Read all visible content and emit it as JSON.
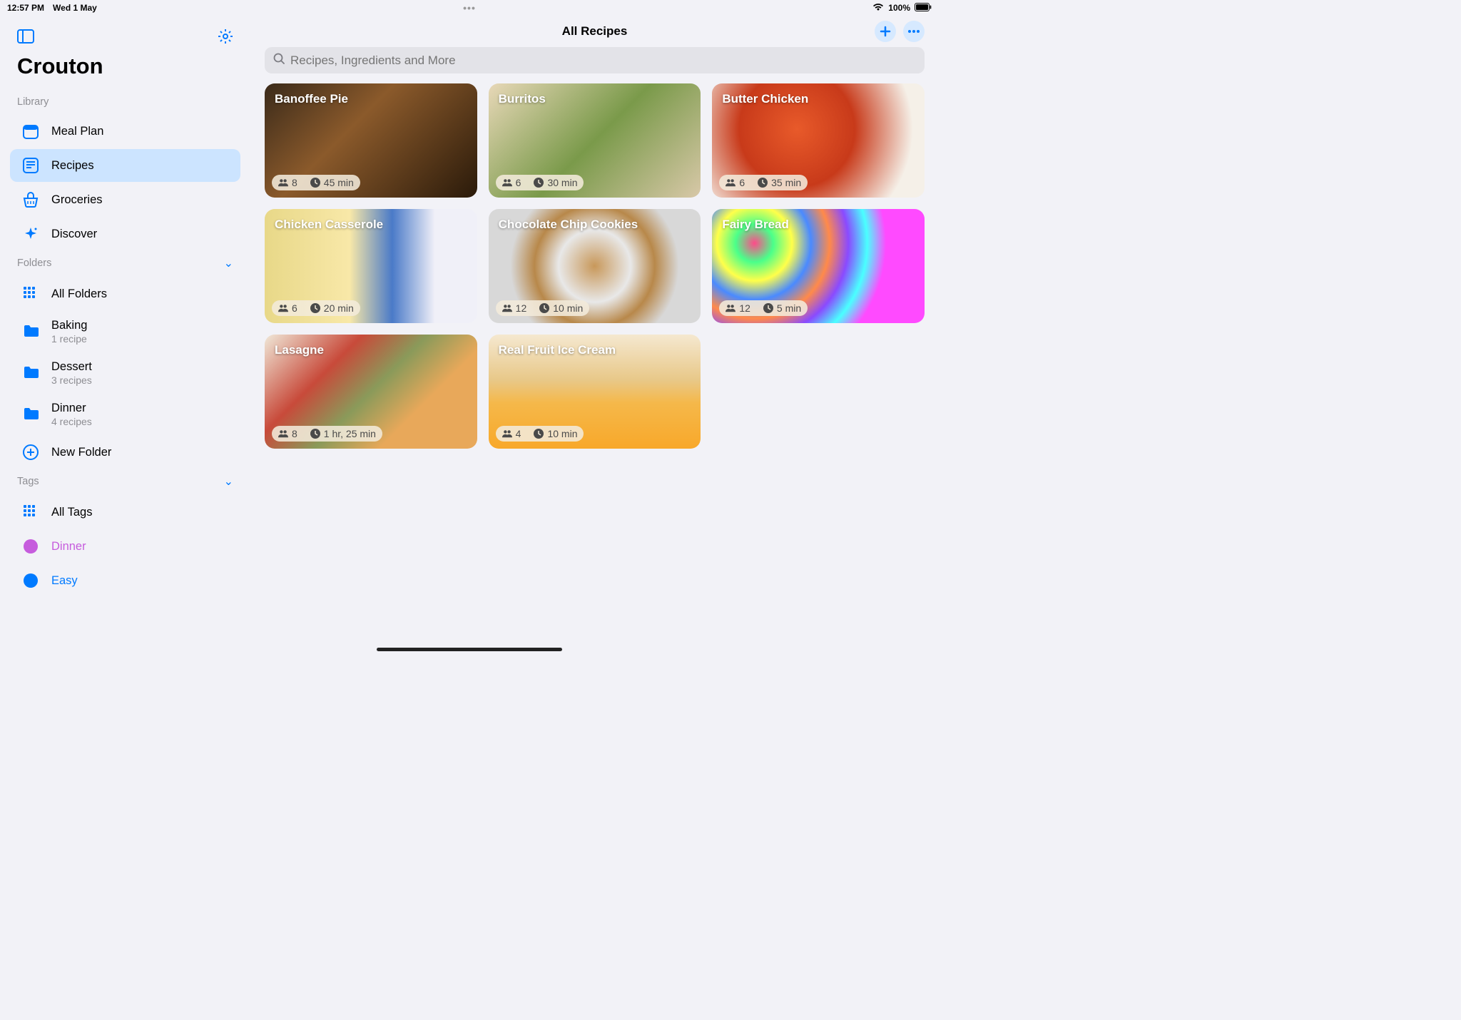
{
  "status": {
    "time": "12:57 PM",
    "date": "Wed 1 May",
    "battery": "100%"
  },
  "app_name": "Crouton",
  "sidebar": {
    "library_label": "Library",
    "folders_label": "Folders",
    "tags_label": "Tags",
    "library_items": [
      {
        "label": "Meal Plan",
        "icon": "calendar"
      },
      {
        "label": "Recipes",
        "icon": "recipe",
        "selected": true
      },
      {
        "label": "Groceries",
        "icon": "basket"
      },
      {
        "label": "Discover",
        "icon": "sparkle"
      }
    ],
    "folders": [
      {
        "label": "All Folders",
        "icon": "grid"
      },
      {
        "label": "Baking",
        "sub": "1 recipe",
        "icon": "folder"
      },
      {
        "label": "Dessert",
        "sub": "3 recipes",
        "icon": "folder"
      },
      {
        "label": "Dinner",
        "sub": "4 recipes",
        "icon": "folder"
      },
      {
        "label": "New Folder",
        "icon": "plus-circle"
      }
    ],
    "tags": [
      {
        "label": "All Tags",
        "icon": "grid"
      },
      {
        "label": "Dinner",
        "color": "#c65cdd"
      },
      {
        "label": "Easy",
        "color": "#007aff"
      }
    ]
  },
  "main": {
    "title": "All Recipes",
    "search_placeholder": "Recipes, Ingredients and More",
    "recipes": [
      {
        "title": "Banoffee Pie",
        "servings": "8",
        "time": "45 min"
      },
      {
        "title": "Burritos",
        "servings": "6",
        "time": "30 min"
      },
      {
        "title": "Butter Chicken",
        "servings": "6",
        "time": "35 min"
      },
      {
        "title": "Chicken Casserole",
        "servings": "6",
        "time": "20 min"
      },
      {
        "title": "Chocolate Chip Cookies",
        "servings": "12",
        "time": "10 min"
      },
      {
        "title": "Fairy Bread",
        "servings": "12",
        "time": "5 min"
      },
      {
        "title": "Lasagne",
        "servings": "8",
        "time": "1 hr, 25 min"
      },
      {
        "title": "Real Fruit Ice Cream",
        "servings": "4",
        "time": "10 min"
      }
    ]
  }
}
